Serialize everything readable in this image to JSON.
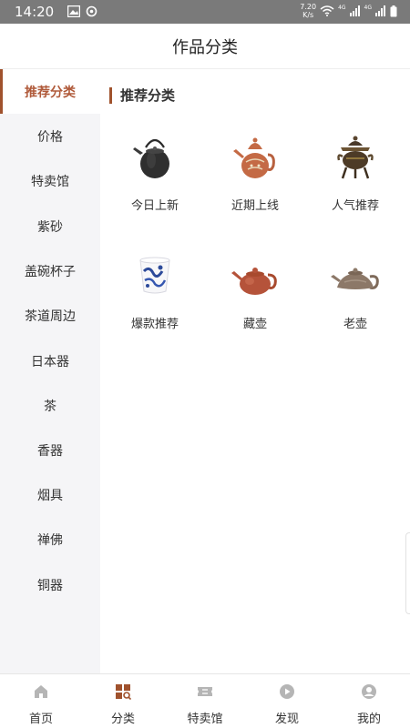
{
  "status_bar": {
    "time": "14:20",
    "net_speed_value": "7.20",
    "net_speed_unit": "K/s",
    "signal_label_1": "4G",
    "signal_label_2": "4G"
  },
  "header": {
    "title": "作品分类"
  },
  "sidebar": {
    "active_index": 0,
    "items": [
      {
        "label": "推荐分类"
      },
      {
        "label": "价格"
      },
      {
        "label": "特卖馆"
      },
      {
        "label": "紫砂"
      },
      {
        "label": "盖碗杯子"
      },
      {
        "label": "茶道周边"
      },
      {
        "label": "日本器"
      },
      {
        "label": "茶"
      },
      {
        "label": "香器"
      },
      {
        "label": "烟具"
      },
      {
        "label": "禅佛"
      },
      {
        "label": "铜器"
      }
    ]
  },
  "main": {
    "section_title": "推荐分类",
    "categories": [
      {
        "label": "今日上新",
        "icon": "iron-kettle-icon"
      },
      {
        "label": "近期上线",
        "icon": "enamel-teapot-icon"
      },
      {
        "label": "人气推荐",
        "icon": "bronze-censer-icon"
      },
      {
        "label": "爆款推荐",
        "icon": "blue-white-cup-icon"
      },
      {
        "label": "藏壶",
        "icon": "red-clay-teapot-icon"
      },
      {
        "label": "老壶",
        "icon": "old-teapot-icon"
      }
    ]
  },
  "bottom_nav": {
    "active_index": 1,
    "accent_color": "#a0522d",
    "items": [
      {
        "label": "首页",
        "icon": "home-icon"
      },
      {
        "label": "分类",
        "icon": "category-icon"
      },
      {
        "label": "特卖馆",
        "icon": "ticket-icon"
      },
      {
        "label": "发现",
        "icon": "play-icon"
      },
      {
        "label": "我的",
        "icon": "profile-icon"
      }
    ]
  }
}
